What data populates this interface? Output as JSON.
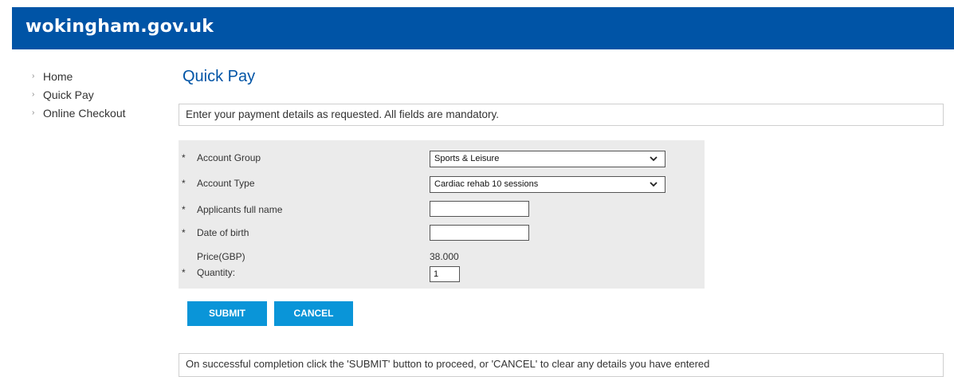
{
  "header": {
    "brand": "wokingham.gov.uk",
    "background_color": "#0054a6"
  },
  "nav": {
    "bullet": "›",
    "items": [
      {
        "label": "Home"
      },
      {
        "label": "Quick Pay"
      },
      {
        "label": "Online Checkout"
      }
    ]
  },
  "main": {
    "title": "Quick Pay",
    "intro": "Enter your payment details as requested. All fields are mandatory.",
    "required_marker": "*",
    "form": {
      "account_group": {
        "label": "Account Group",
        "value": "Sports & Leisure"
      },
      "account_type": {
        "label": "Account Type",
        "value": "Cardiac rehab 10 sessions"
      },
      "applicant_name": {
        "label": "Applicants full name",
        "value": ""
      },
      "date_of_birth": {
        "label": "Date of birth",
        "value": ""
      },
      "price": {
        "label": "Price(GBP)",
        "value": "38.000"
      },
      "quantity": {
        "label": "Quantity:",
        "value": "1"
      }
    },
    "buttons": {
      "submit": "SUBMIT",
      "cancel": "CANCEL",
      "color": "#0a95d8"
    },
    "footer_note": "On successful completion click the 'SUBMIT' button to proceed, or 'CANCEL' to clear any details you have entered"
  },
  "icons": {
    "dropdown": "chevron-down-icon"
  }
}
